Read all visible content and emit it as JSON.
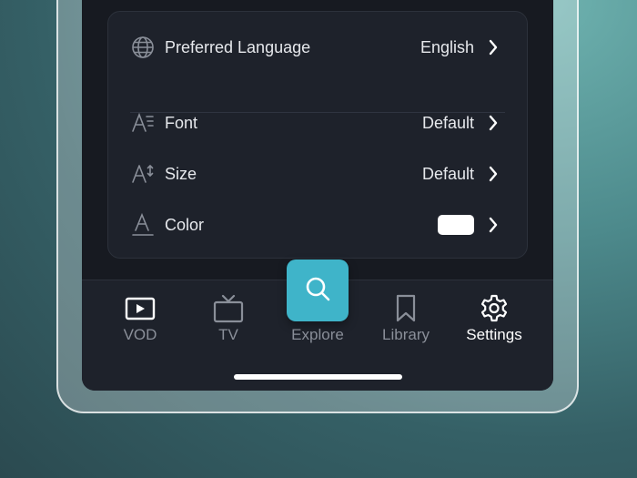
{
  "settings": {
    "rows": [
      {
        "label": "Preferred Language",
        "value": "English",
        "icon": "globe-icon"
      },
      {
        "label": "Font",
        "value": "Default",
        "icon": "font-style-icon"
      },
      {
        "label": "Size",
        "value": "Default",
        "icon": "font-size-icon"
      },
      {
        "label": "Color",
        "value": "",
        "icon": "font-color-icon",
        "swatch_color": "#ffffff"
      }
    ]
  },
  "tabbar": {
    "tabs": [
      {
        "label": "VOD",
        "icon": "play-icon",
        "state": "dim-white"
      },
      {
        "label": "TV",
        "icon": "tv-icon",
        "state": "dim"
      },
      {
        "label": "Explore",
        "icon": "search-icon",
        "state": "dim"
      },
      {
        "label": "Library",
        "icon": "bookmark-icon",
        "state": "dim"
      },
      {
        "label": "Settings",
        "icon": "gear-icon",
        "state": "active"
      }
    ],
    "accent_color": "#3fb4c9"
  }
}
